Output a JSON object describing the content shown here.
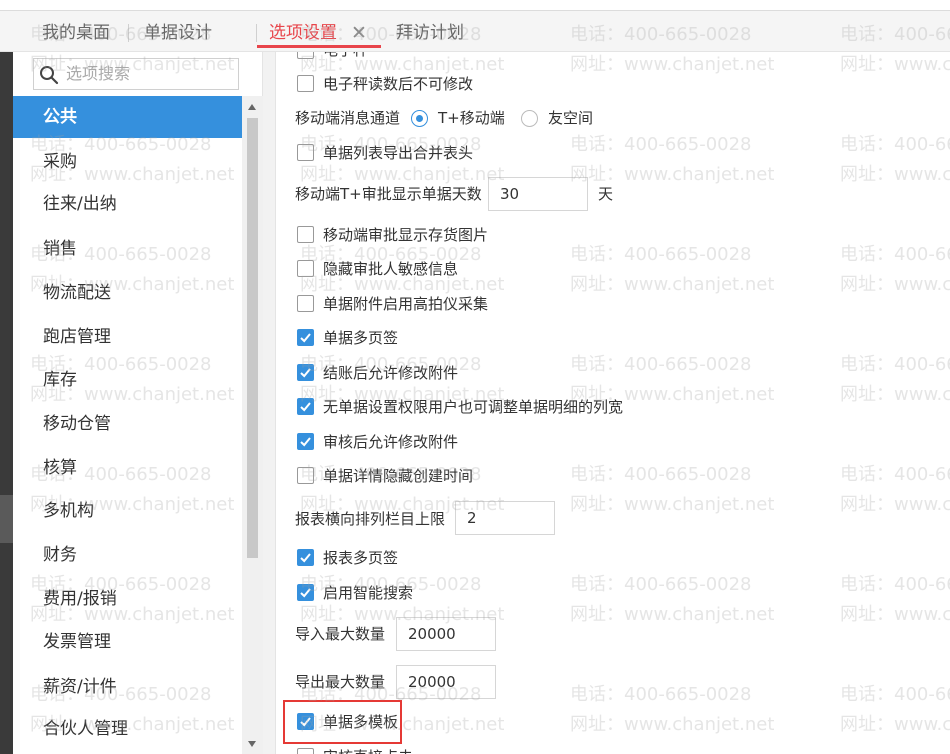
{
  "tabs": {
    "t1": "我的桌面",
    "t2": "单据设计",
    "t3": "选项设置",
    "t4": "拜访计划",
    "close": "✕"
  },
  "sidebar": {
    "search_placeholder": "选项搜索",
    "items": [
      "公共",
      "采购",
      "往来/出纳",
      "销售",
      "物流配送",
      "跑店管理",
      "库存",
      "移动仓管",
      "核算",
      "多机构",
      "财务",
      "费用/报销",
      "发票管理",
      "薪资/计件",
      "合伙人管理"
    ]
  },
  "options": {
    "cut_top": "电子秤",
    "scale_readonly": "电子秤读数后不可修改",
    "msg_channel_label": "移动端消息通道",
    "radio_tplus": "T+移动端",
    "radio_friend": "友空间",
    "merge_header": "单据列表导出合并表头",
    "days_label": "移动端T+审批显示单据天数",
    "days_value": "30",
    "days_unit": "天",
    "show_image": "移动端审批显示存货图片",
    "hide_sensitive": "隐藏审批人敏感信息",
    "camera": "单据附件启用高拍仪采集",
    "multi_page": "单据多页签",
    "after_close_edit": "结账后允许修改附件",
    "no_perm_adjust": "无单据设置权限用户也可调整单据明细的列宽",
    "after_audit_edit": "审核后允许修改附件",
    "hide_create_time": "单据详情隐藏创建时间",
    "report_cols_label": "报表横向排列栏目上限",
    "report_cols_value": "2",
    "report_multi_page": "报表多页签",
    "smart_search": "启用智能搜索",
    "import_max_label": "导入最大数量",
    "import_max_value": "20000",
    "export_max_label": "导出最大数量",
    "export_max_value": "20000",
    "multi_template": "单据多模板",
    "cut_bottom": "审核直接点击"
  },
  "watermark": {
    "phone": "电话：400-665-0028",
    "site": "网址：www.chanjet.net"
  },
  "colors": {
    "accent_red": "#e8454b",
    "active_blue": "#3590dd",
    "highlight_red": "#e53935"
  }
}
